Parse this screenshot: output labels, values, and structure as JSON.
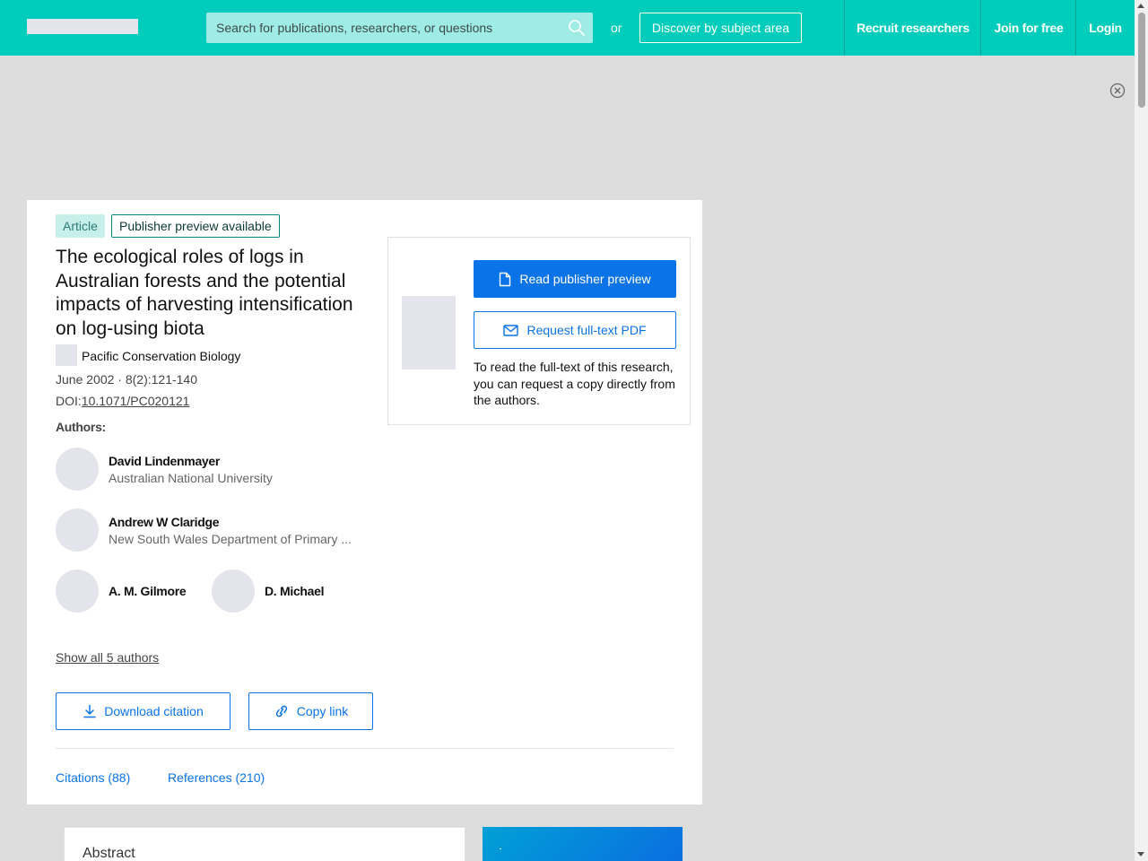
{
  "header": {
    "search_placeholder": "Search for publications, researchers, or questions",
    "or_text": "or",
    "discover_label": "Discover by subject area",
    "nav": {
      "recruit": "Recruit researchers",
      "join": "Join for free",
      "login": "Login"
    }
  },
  "article": {
    "type_badge": "Article",
    "preview_badge": "Publisher preview available",
    "title": "The ecological roles of logs in Australian forests and the potential impacts of harvesting intensification on log-using biota",
    "journal": "Pacific Conservation Biology",
    "meta": "June 2002 · 8(2):121-140",
    "doi_prefix": "DOI:",
    "doi": "10.1071/PC020121",
    "authors_label": "Authors:",
    "authors": [
      {
        "name": "David Lindenmayer",
        "affiliation": "Australian National University"
      },
      {
        "name": "Andrew W Claridge",
        "affiliation": "New South Wales Department of Primary ..."
      },
      {
        "name": "A. M. Gilmore"
      },
      {
        "name": "D. Michael"
      }
    ],
    "show_all": "Show all 5 authors",
    "download_citation": "Download citation",
    "copy_link": "Copy link",
    "tabs": {
      "citations": "Citations (88)",
      "references": "References (210)"
    }
  },
  "request_panel": {
    "read_preview": "Read publisher preview",
    "request_pdf": "Request full-text PDF",
    "note": "To read the full-text of this research, you can request a copy directly from the authors."
  },
  "abstract": {
    "title": "Abstract"
  },
  "colors": {
    "header": "#00ccbb",
    "primary": "#0a73e8",
    "badge_bg": "#c6efea",
    "badge_border": "#00867a"
  },
  "icons": [
    "search-icon",
    "close-circle-icon",
    "document-icon",
    "mail-icon",
    "download-icon",
    "link-icon"
  ]
}
